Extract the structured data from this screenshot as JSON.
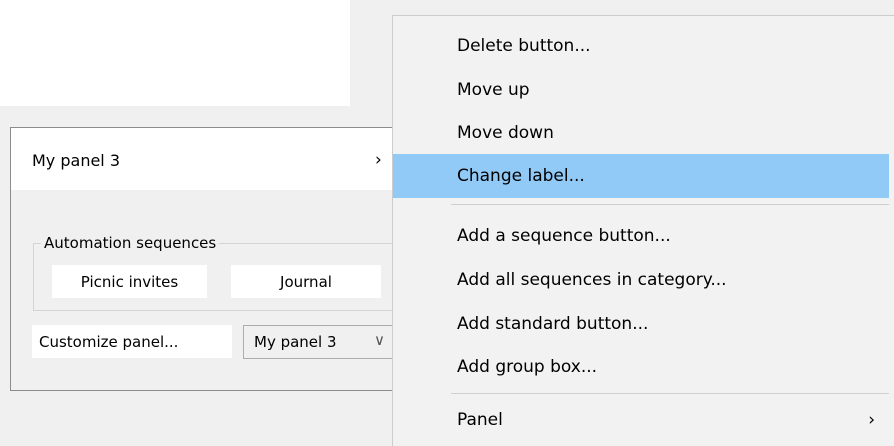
{
  "panel": {
    "title": "My panel 3",
    "header_chevron_glyph": "›",
    "group_label": "Automation sequences",
    "buttons": [
      "Picnic invites",
      "Journal"
    ],
    "customize_label": "Customize panel...",
    "selector": {
      "value": "My panel 3",
      "arrow_glyph": "∨"
    }
  },
  "menu": {
    "items": [
      "Delete button...",
      "Move up",
      "Move down",
      "Change label...",
      "Add a sequence button...",
      "Add all sequences in category...",
      "Add standard button...",
      "Add group box...",
      "Panel"
    ],
    "highlighted_item": "Change label...",
    "submenu_arrow_glyph": "›"
  },
  "colors": {
    "highlight": "#91c9f7",
    "background": "#f0f0f0",
    "menu_background": "#f2f2f2"
  }
}
